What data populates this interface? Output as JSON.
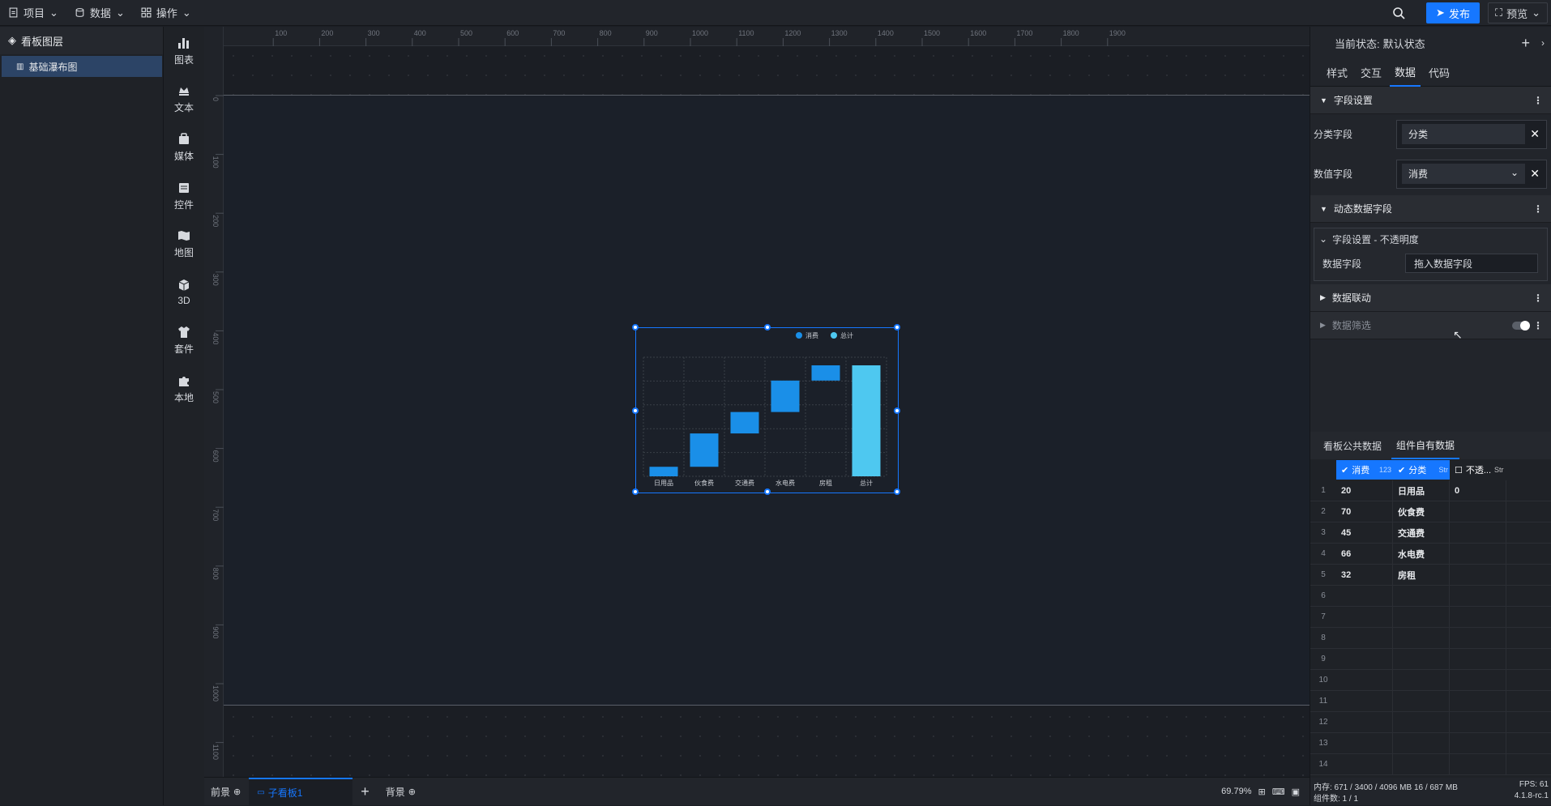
{
  "topbar": {
    "menus": [
      {
        "label": "项目"
      },
      {
        "label": "数据"
      },
      {
        "label": "操作"
      }
    ],
    "publish_label": "发布",
    "preview_label": "预览"
  },
  "layers": {
    "title": "看板图层",
    "items": [
      {
        "label": "基础瀑布图"
      }
    ]
  },
  "tools": [
    {
      "label": "图表",
      "icon": "chart-icon"
    },
    {
      "label": "文本",
      "icon": "text-icon"
    },
    {
      "label": "媒体",
      "icon": "media-icon"
    },
    {
      "label": "控件",
      "icon": "control-icon"
    },
    {
      "label": "地图",
      "icon": "map-icon"
    },
    {
      "label": "3D",
      "icon": "cube-icon"
    },
    {
      "label": "套件",
      "icon": "shirt-icon"
    },
    {
      "label": "本地",
      "icon": "puzzle-icon"
    }
  ],
  "ruler": {
    "h_ticks": [
      "100",
      "200",
      "300",
      "400",
      "500",
      "600",
      "700",
      "800",
      "900",
      "1000",
      "1100",
      "1200",
      "1300",
      "1400",
      "1500",
      "1600",
      "1700",
      "1800",
      "1900"
    ],
    "v_ticks": [
      "0",
      "100",
      "200",
      "300",
      "400",
      "500",
      "600",
      "700",
      "800",
      "900",
      "1000",
      "1100"
    ]
  },
  "chart_data": {
    "type": "bar",
    "categories": [
      "日用品",
      "伙食费",
      "交通费",
      "水电费",
      "房租",
      "总计"
    ],
    "series": [
      {
        "name": "消费",
        "values": [
          20,
          70,
          45,
          66,
          32
        ]
      },
      {
        "name": "总计",
        "values": [
          233
        ]
      }
    ],
    "base": [
      0,
      20,
      90,
      135,
      201,
      0
    ],
    "values": [
      20,
      70,
      45,
      66,
      32,
      233
    ],
    "ylim": [
      0,
      250
    ],
    "grid": true,
    "legend": "top-right",
    "colors": {
      "consume": "#1a8fe8",
      "total": "#4ec8f0"
    }
  },
  "bottom": {
    "tabs": [
      {
        "label": "前景"
      },
      {
        "label": "子看板1"
      },
      {
        "label": "背景"
      }
    ],
    "zoom": "69.79%"
  },
  "right": {
    "state_label": "当前状态:",
    "state_value": "默认状态",
    "tabs": [
      "样式",
      "交互",
      "数据",
      "代码"
    ],
    "field_section": "字段设置",
    "category_label": "分类字段",
    "category_value": "分类",
    "value_label": "数值字段",
    "value_value": "消费",
    "dynamic_section": "动态数据字段",
    "sub_title": "字段设置 - 不透明度",
    "sub_label": "数据字段",
    "sub_placeholder": "拖入数据字段",
    "link_section": "数据联动",
    "filter_section": "数据筛选",
    "data_tabs": [
      "看板公共数据",
      "组件自有数据"
    ],
    "columns": [
      {
        "label": "消费",
        "type": "123"
      },
      {
        "label": "分类",
        "type": "Str"
      },
      {
        "label": "不透...",
        "type": "Str"
      }
    ],
    "rows": [
      {
        "n": "1",
        "a": "20",
        "b": "日用品",
        "c": "0"
      },
      {
        "n": "2",
        "a": "70",
        "b": "伙食费",
        "c": ""
      },
      {
        "n": "3",
        "a": "45",
        "b": "交通费",
        "c": ""
      },
      {
        "n": "4",
        "a": "66",
        "b": "水电费",
        "c": ""
      },
      {
        "n": "5",
        "a": "32",
        "b": "房租",
        "c": ""
      },
      {
        "n": "6",
        "a": "",
        "b": "",
        "c": ""
      },
      {
        "n": "7",
        "a": "",
        "b": "",
        "c": ""
      },
      {
        "n": "8",
        "a": "",
        "b": "",
        "c": ""
      },
      {
        "n": "9",
        "a": "",
        "b": "",
        "c": ""
      },
      {
        "n": "10",
        "a": "",
        "b": "",
        "c": ""
      },
      {
        "n": "11",
        "a": "",
        "b": "",
        "c": ""
      },
      {
        "n": "12",
        "a": "",
        "b": "",
        "c": ""
      },
      {
        "n": "13",
        "a": "",
        "b": "",
        "c": ""
      },
      {
        "n": "14",
        "a": "",
        "b": "",
        "c": ""
      }
    ],
    "status_mem": "内存: 671 / 3400 / 4096 MB 16 / 687 MB",
    "status_fps": "FPS: 61",
    "status_count": "组件数: 1 / 1",
    "status_version": "4.1.8-rc.1"
  }
}
